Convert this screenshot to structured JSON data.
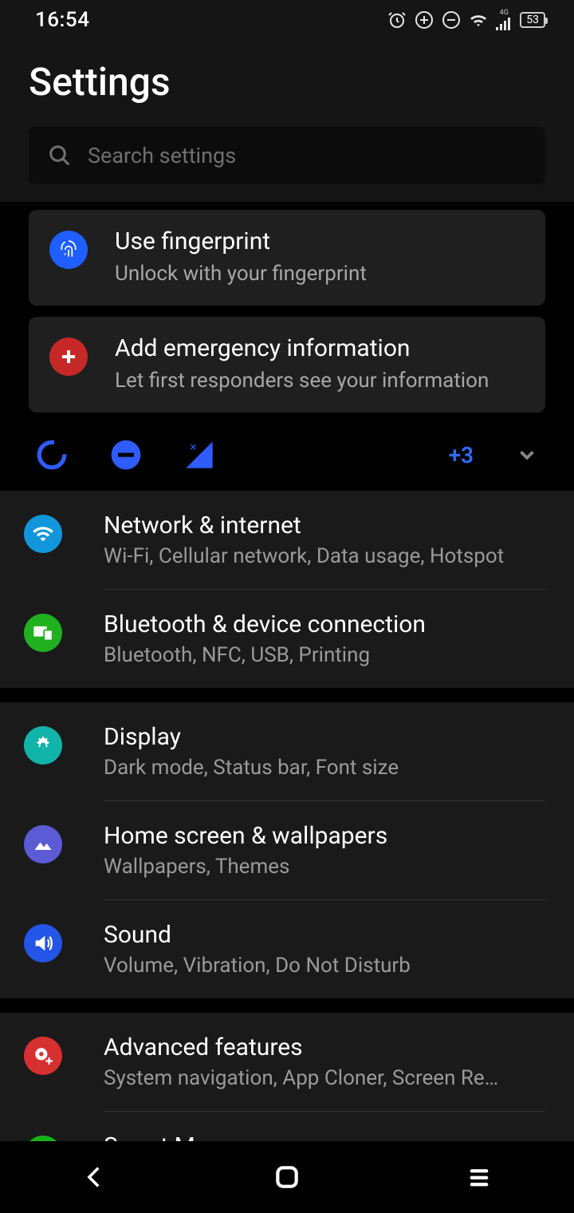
{
  "status": {
    "time": "16:54",
    "network_label": "4G",
    "battery": "53"
  },
  "header": {
    "title": "Settings"
  },
  "search": {
    "placeholder": "Search settings"
  },
  "suggestions": [
    {
      "title": "Use fingerprint",
      "sub": "Unlock with your fingerprint",
      "icon": "fingerprint",
      "bg": "#1f5eff"
    },
    {
      "title": "Add emergency information",
      "sub": "Let first responders see your information",
      "icon": "medical",
      "bg": "#c62828"
    }
  ],
  "quick_more": "+3",
  "sections": [
    [
      {
        "title": "Network & internet",
        "sub": "Wi-Fi, Cellular network, Data usage, Hotspot",
        "icon": "wifi",
        "bg": "#1296db"
      },
      {
        "title": "Bluetooth & device connection",
        "sub": "Bluetooth, NFC, USB, Printing",
        "icon": "devices",
        "bg": "#20b020"
      }
    ],
    [
      {
        "title": "Display",
        "sub": "Dark mode, Status bar, Font size",
        "icon": "brightness",
        "bg": "#12b3a8"
      },
      {
        "title": "Home screen & wallpapers",
        "sub": "Wallpapers, Themes",
        "icon": "wallpaper",
        "bg": "#5b5bd6"
      },
      {
        "title": "Sound",
        "sub": "Volume, Vibration, Do Not Disturb",
        "icon": "sound",
        "bg": "#2355e6"
      }
    ],
    [
      {
        "title": "Advanced features",
        "sub": "System navigation, App Cloner, Screen Re…",
        "icon": "gear-plus",
        "bg": "#d63031"
      },
      {
        "title": "Smart Manager",
        "sub": "",
        "icon": "shield",
        "bg": "#16b316"
      }
    ]
  ]
}
